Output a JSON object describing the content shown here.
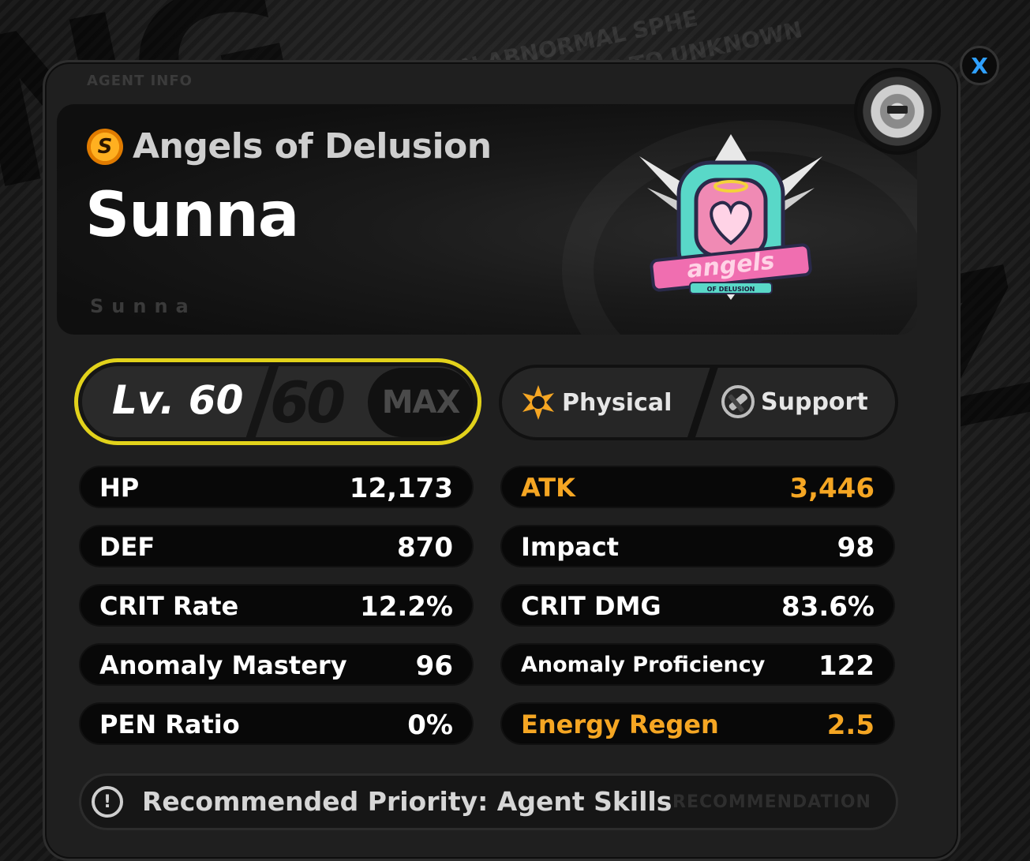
{
  "background": {
    "text_line_1": "AN ABNORMAL SPHE",
    "text_line_2": "EPLY DUE TO UNKNOWN"
  },
  "close_button": {
    "label": "X"
  },
  "panel": {
    "tag": "AGENT INFO",
    "faction_icon_letter": "S",
    "faction": "Angels of Delusion",
    "agent_name": "Sunna",
    "agent_subtitle": "Sunna"
  },
  "level": {
    "label": "Lv. 60",
    "max_level": "60",
    "badge": "MAX"
  },
  "attributes": {
    "element": "Physical",
    "specialty": "Support"
  },
  "stats": {
    "left": [
      {
        "name": "HP",
        "value": "12,173"
      },
      {
        "name": "DEF",
        "value": "870"
      },
      {
        "name": "CRIT Rate",
        "value": "12.2%"
      },
      {
        "name": "Anomaly Mastery",
        "value": "96"
      },
      {
        "name": "PEN Ratio",
        "value": "0%"
      }
    ],
    "right": [
      {
        "name": "ATK",
        "value": "3,446",
        "highlight": true
      },
      {
        "name": "Impact",
        "value": "98"
      },
      {
        "name": "CRIT DMG",
        "value": "83.6%"
      },
      {
        "name": "Anomaly Proficiency",
        "value": "122"
      },
      {
        "name": "Energy Regen",
        "value": "2.5",
        "highlight": true
      }
    ]
  },
  "recommendation": {
    "icon_glyph": "!",
    "text": "Recommended Priority: Agent Skills",
    "ghost_text": "RECOMMENDATION"
  },
  "colors": {
    "highlight": "#f5a623",
    "level_border": "#e2d21b",
    "close_x": "#2fa0ff"
  }
}
